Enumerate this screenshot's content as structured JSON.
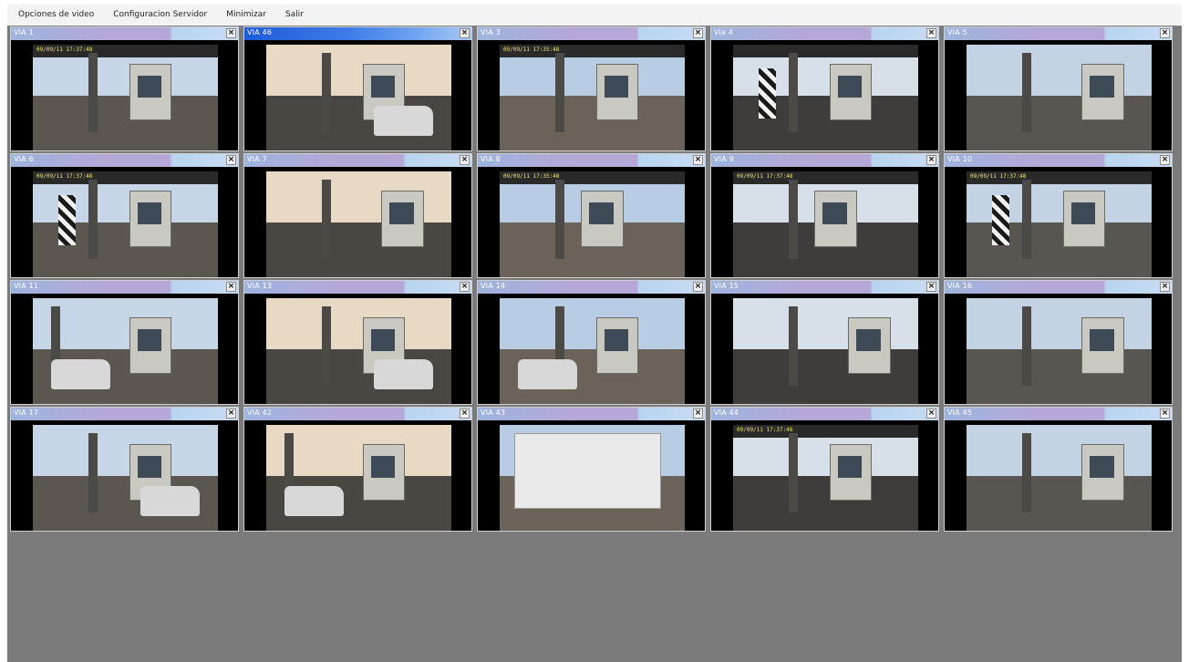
{
  "menu": [
    "Opciones de video",
    "Configuracion Servidor",
    "Minimizar",
    "Salir"
  ],
  "close_glyph": "×",
  "colors": {
    "desktop_bg": "#7b7b7b",
    "menubar_bg": "#f3f3f3",
    "title_active": "#1e5bd8",
    "title_inactive": "#b5a8d9"
  },
  "cameras": [
    {
      "title": "VIA 1",
      "active": false,
      "stamp": "09/09/11 17:37:48",
      "scene": "toll-roof"
    },
    {
      "title": "VIA 46",
      "active": true,
      "stamp": "",
      "scene": "booth-car"
    },
    {
      "title": "VIA 3",
      "active": false,
      "stamp": "09/09/11 17:35:48",
      "scene": "toll-roof"
    },
    {
      "title": "Via 4",
      "active": false,
      "stamp": "",
      "scene": "stripe-booth"
    },
    {
      "title": "VIA 5",
      "active": false,
      "stamp": "",
      "scene": "booth-right"
    },
    {
      "title": "VIA 6",
      "active": false,
      "stamp": "09/09/11 17:37:48",
      "scene": "stripe-booth"
    },
    {
      "title": "VIA 7",
      "active": false,
      "stamp": "",
      "scene": "booth-right"
    },
    {
      "title": "VIA 8",
      "active": false,
      "stamp": "09/09/11 17:35:48",
      "scene": "booth-center"
    },
    {
      "title": "VIA 9",
      "active": false,
      "stamp": "09/09/11 17:37:48",
      "scene": "booth-center"
    },
    {
      "title": "VIA 10",
      "active": false,
      "stamp": "09/09/11 17:37:48",
      "scene": "stripe-booth"
    },
    {
      "title": "VIA 11",
      "active": false,
      "stamp": "",
      "scene": "road"
    },
    {
      "title": "VIA 13",
      "active": false,
      "stamp": "",
      "scene": "booth-car"
    },
    {
      "title": "VIA 14",
      "active": false,
      "stamp": "",
      "scene": "booth-car"
    },
    {
      "title": "VIA 15",
      "active": false,
      "stamp": "",
      "scene": "booth-right"
    },
    {
      "title": "VIA 16",
      "active": false,
      "stamp": "",
      "scene": "booth-right"
    },
    {
      "title": "VIA 17",
      "active": false,
      "stamp": "",
      "scene": "booth-car"
    },
    {
      "title": "VIA 42",
      "active": false,
      "stamp": "",
      "scene": "road"
    },
    {
      "title": "VIA 43",
      "active": false,
      "stamp": "",
      "scene": "truck"
    },
    {
      "title": "VIA 44",
      "active": false,
      "stamp": "09/09/11 17:37:48",
      "scene": "toll-roof"
    },
    {
      "title": "VIA 45",
      "active": false,
      "stamp": "",
      "scene": "booth-right"
    }
  ]
}
